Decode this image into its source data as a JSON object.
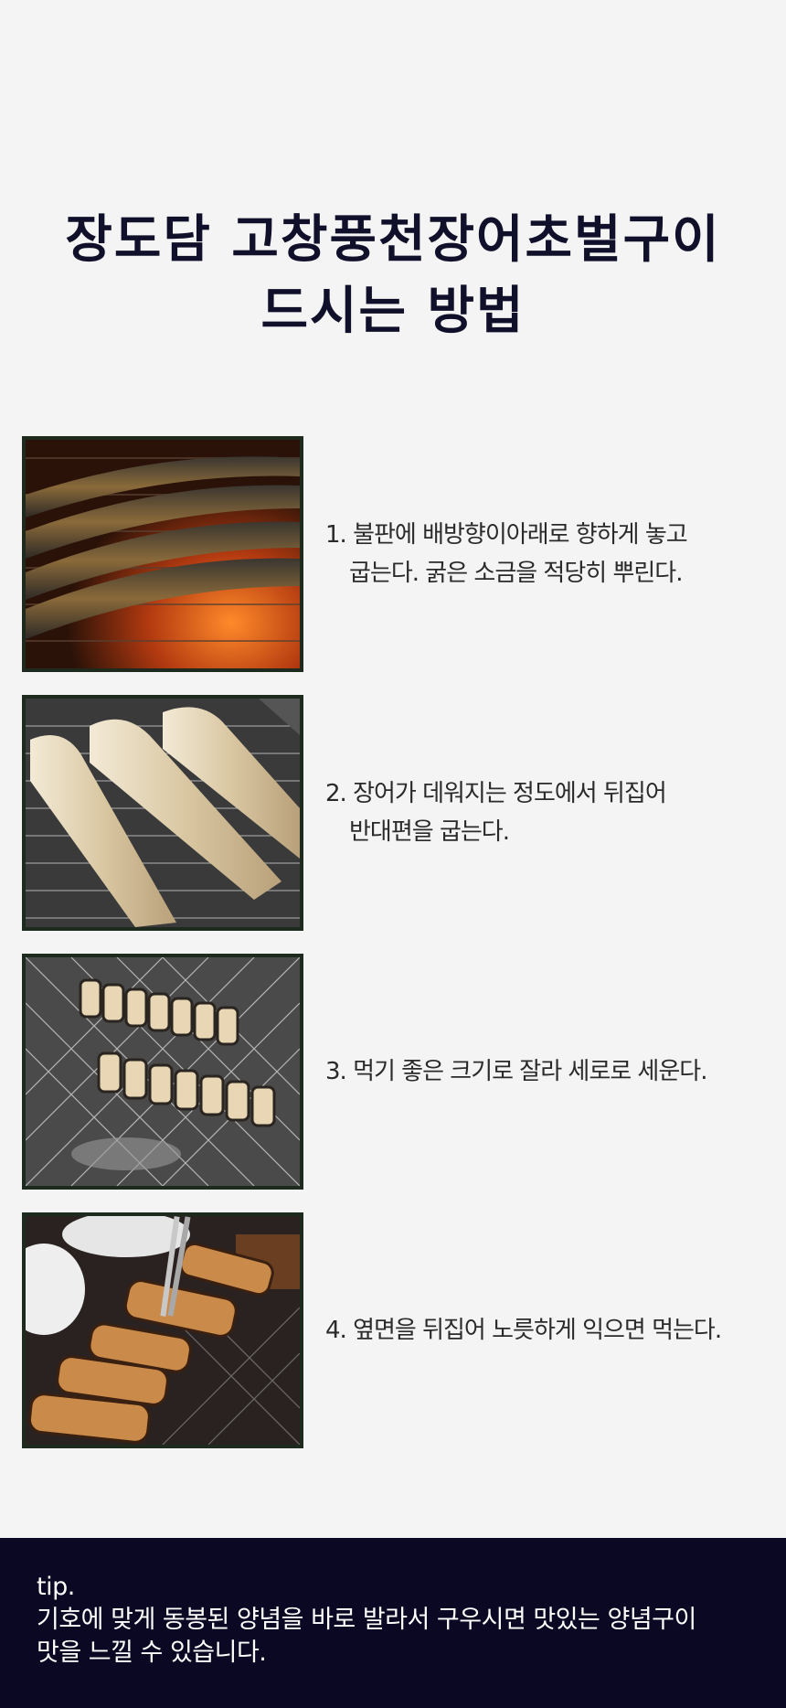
{
  "title": {
    "line1": "장도담 고창풍천장어초벌구이",
    "line2": "드시는 방법"
  },
  "steps": [
    {
      "line1": "1. 불판에 배방향이아래로 향하게 놓고",
      "line2": "굽는다. 굵은 소금을 적당히 뿌린다.",
      "image": "grilled-eel-on-fire-grill-photo"
    },
    {
      "line1": "2. 장어가 데워지는 정도에서 뒤집어",
      "line2": "반대편을 굽는다.",
      "image": "eel-fillets-flipped-on-grill-photo"
    },
    {
      "line1": "3. 먹기 좋은 크기로 잘라 세로로 세운다.",
      "line2": "",
      "image": "cut-eel-pieces-standing-on-grill-photo"
    },
    {
      "line1": "4. 옆면을 뒤집어 노릇하게 익으면 먹는다.",
      "line2": "",
      "image": "tongs-holding-cooked-eel-photo"
    }
  ],
  "tip": {
    "label": "tip.",
    "line1": "기호에 맞게 동봉된 양념을 바로 발라서 구우시면 맛있는 양념구이",
    "line2": "맛을 느낄 수 있습니다."
  },
  "colors": {
    "background": "#f4f4f4",
    "title": "#10102a",
    "tip_background": "#0b0823",
    "photo_border": "#1f2a1f"
  }
}
